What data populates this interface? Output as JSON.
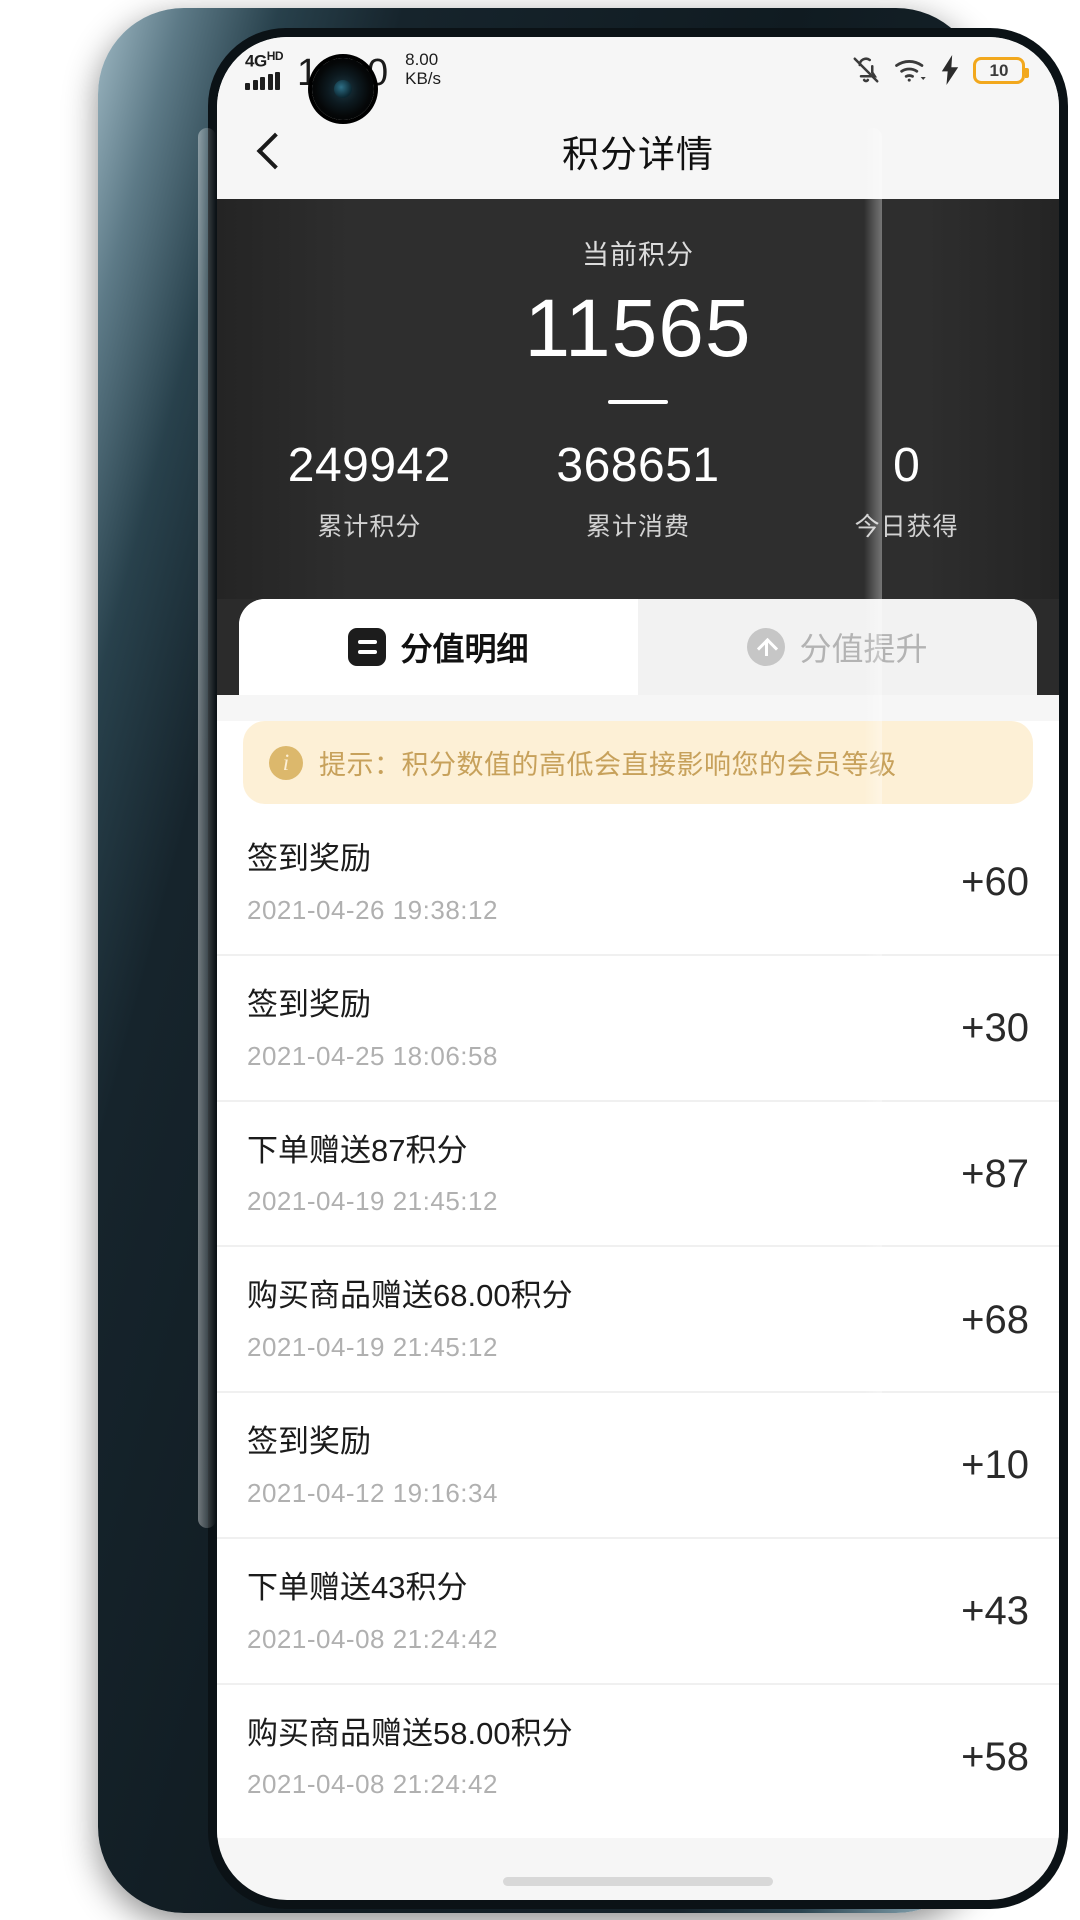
{
  "status_bar": {
    "network_type": "4G",
    "network_suffix": "HD",
    "time": "16:00",
    "net_speed_value": "8.00",
    "net_speed_unit": "KB/s",
    "battery_level": "10",
    "icons": {
      "signal": "signal-bars-icon",
      "mute": "bell-off-icon",
      "wifi": "wifi-icon",
      "charging": "lightning-bolt-icon",
      "battery": "battery-icon"
    },
    "colors": {
      "battery": "#f2a81d"
    }
  },
  "header": {
    "title": "积分详情",
    "back_icon": "chevron-left-icon"
  },
  "summary": {
    "current_label": "当前积分",
    "current_value": "11565",
    "stats": [
      {
        "value": "249942",
        "caption": "累计积分"
      },
      {
        "value": "368651",
        "caption": "累计消费"
      },
      {
        "value": "0",
        "caption": "今日获得"
      }
    ],
    "colors": {
      "background": "#2b2b2b",
      "text": "#ffffff"
    }
  },
  "tabs": [
    {
      "label": "分值明细",
      "icon": "list-icon",
      "active": true
    },
    {
      "label": "分值提升",
      "icon": "arrow-up-circle-icon",
      "active": false
    }
  ],
  "tip": {
    "icon": "info-icon",
    "text": "提示：积分数值的高低会直接影响您的会员等级",
    "colors": {
      "background": "#fdf0d6",
      "text": "#c7a15b"
    }
  },
  "transactions": [
    {
      "title": "签到奖励",
      "time": "2021-04-26 19:38:12",
      "amount": "+60"
    },
    {
      "title": "签到奖励",
      "time": "2021-04-25 18:06:58",
      "amount": "+30"
    },
    {
      "title": "下单赠送87积分",
      "time": "2021-04-19 21:45:12",
      "amount": "+87"
    },
    {
      "title": "购买商品赠送68.00积分",
      "time": "2021-04-19 21:45:12",
      "amount": "+68"
    },
    {
      "title": "签到奖励",
      "time": "2021-04-12 19:16:34",
      "amount": "+10"
    },
    {
      "title": "下单赠送43积分",
      "time": "2021-04-08 21:24:42",
      "amount": "+43"
    },
    {
      "title": "购买商品赠送58.00积分",
      "time": "2021-04-08 21:24:42",
      "amount": "+58"
    }
  ]
}
